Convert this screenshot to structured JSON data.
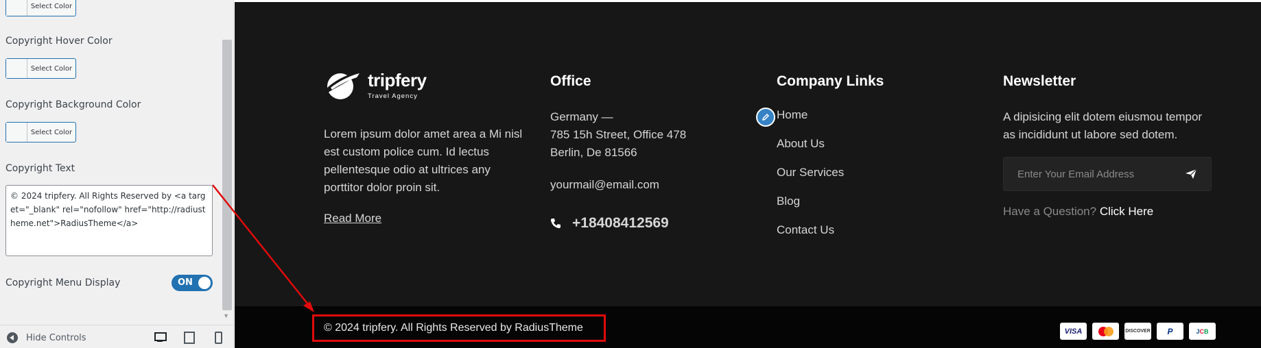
{
  "panel": {
    "select_color_label": "Select Color",
    "hover_label": "Copyright Hover Color",
    "bg_label": "Copyright Background Color",
    "text_label": "Copyright Text",
    "text_value": "© 2024 tripfery. All Rights Reserved by <a target=\"_blank\" rel=\"nofollow\" href=\"http://radiustheme.net\">RadiusTheme</a>",
    "menu_label": "Copyright Menu Display",
    "toggle_label": "ON",
    "hide_controls": "Hide Controls"
  },
  "footer": {
    "logo_name": "tripfery",
    "logo_tagline": "Travel Agency",
    "about": "Lorem ipsum dolor amet area a Mi nisl est custom police cum. Id lectus pellentesque odio at ultrices any porttitor dolor proin sit.",
    "read_more": "Read More",
    "office_title": "Office",
    "office_line1": "Germany —",
    "office_line2": "785 15h Street, Office 478",
    "office_line3": "Berlin, De 81566",
    "email": "yourmail@email.com",
    "phone": "+18408412569",
    "links_title": "Company Links",
    "links": [
      "Home",
      "About Us",
      "Our Services",
      "Blog",
      "Contact Us"
    ],
    "news_title": "Newsletter",
    "news_text": "A dipisicing elit dotem eiusmou tempor as incididunt ut labore sed dotem.",
    "email_placeholder": "Enter Your Email Address",
    "question": "Have a Question?",
    "click_here": "Click Here",
    "copyright": "© 2024 tripfery. All Rights Reserved by RadiusTheme",
    "cards": [
      "VISA",
      "mastercard",
      "DISCOVER",
      "PayPal",
      "JCB"
    ]
  },
  "colors": {
    "accent": "#2271b1",
    "highlight": "#e00b0b",
    "footer_bg": "#171717"
  }
}
